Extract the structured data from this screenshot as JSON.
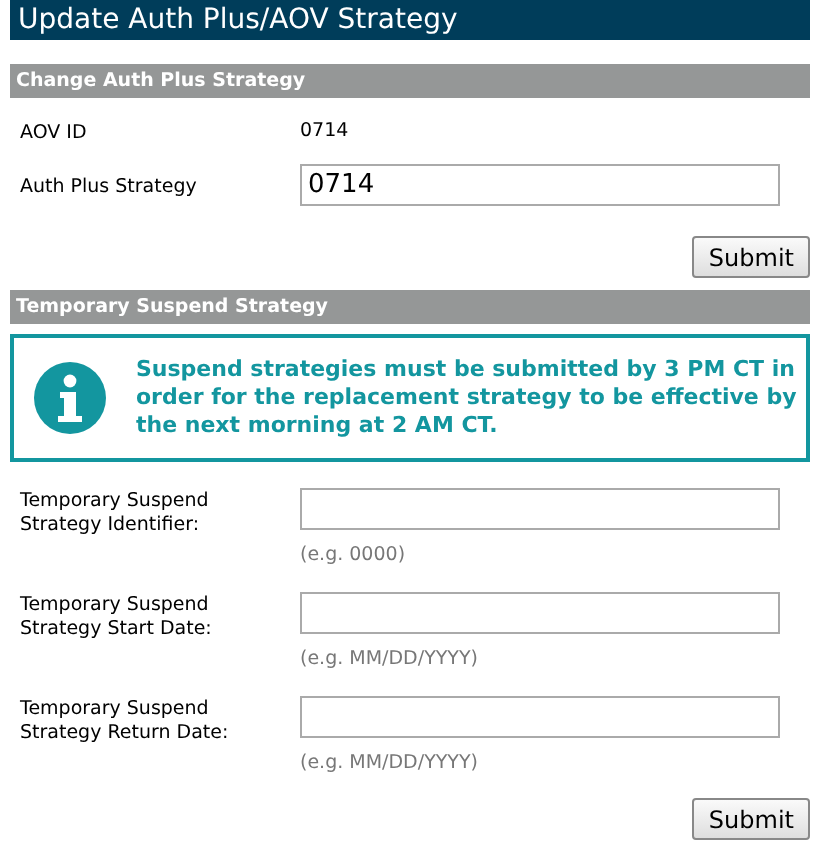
{
  "title": "Update Auth Plus/AOV Strategy",
  "sections": [
    {
      "header": "Change Auth Plus Strategy",
      "rows": [
        {
          "kind": "text",
          "label": "AOV ID",
          "value": "0714"
        },
        {
          "kind": "input",
          "label": "Auth Plus Strategy",
          "value": "0714"
        }
      ],
      "submit": "Submit"
    },
    {
      "header": "Temporary Suspend Strategy",
      "notice": "Suspend strategies must be submitted by 3 PM CT in order for the replacement strategy to be effective by the next morning at 2 AM CT.",
      "rows": [
        {
          "kind": "input",
          "label": "Temporary Suspend Strategy Identifier:",
          "hint": "(e.g. 0000)"
        },
        {
          "kind": "input",
          "label": "Temporary Suspend Strategy Start Date:",
          "hint": "(e.g. MM/DD/YYYY)"
        },
        {
          "kind": "input",
          "label": "Temporary Suspend Strategy Return Date:",
          "hint": "(e.g. MM/DD/YYYY)"
        }
      ],
      "submit": "Submit"
    }
  ]
}
